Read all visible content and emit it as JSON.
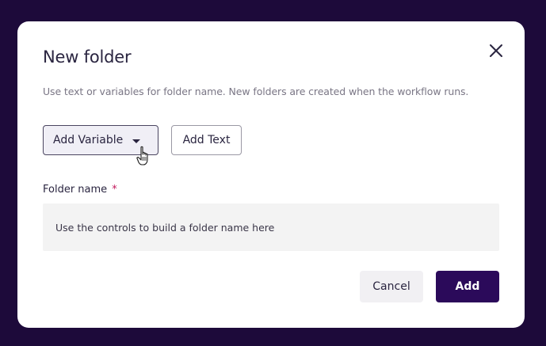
{
  "dialog": {
    "title": "New folder",
    "subtitle": "Use text or variables for folder name. New folders are created when the workflow runs.",
    "close_icon": "close-icon"
  },
  "actions": {
    "add_variable_label": "Add Variable",
    "add_variable_icon": "caret-down-icon",
    "add_text_label": "Add Text"
  },
  "folder_name": {
    "label": "Folder name",
    "required_marker": "*",
    "placeholder": "Use the controls to build a folder name here"
  },
  "footer": {
    "cancel_label": "Cancel",
    "add_label": "Add"
  },
  "colors": {
    "backdrop": "#1d0a3a",
    "primary": "#2b0a5a",
    "required": "#c2185b"
  },
  "cursor": "hand-pointer-icon"
}
